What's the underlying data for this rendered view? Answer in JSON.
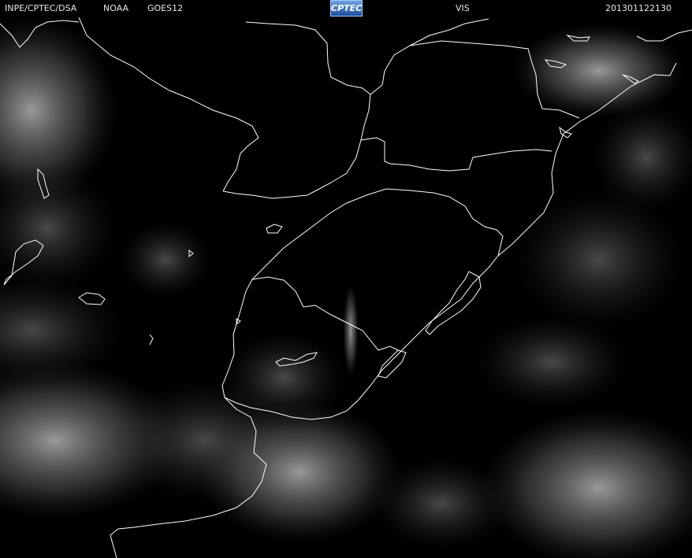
{
  "header": {
    "source": "INPE/CPTEC/DSA",
    "agency": "NOAA",
    "satellite": "GOES12",
    "logo_text": "CPTEC",
    "channel": "VIS",
    "timestamp": "201301122130"
  },
  "map": {
    "background": "#000000",
    "coastline_color": "#ffffff",
    "cloud_color": "#9a9a9a"
  }
}
